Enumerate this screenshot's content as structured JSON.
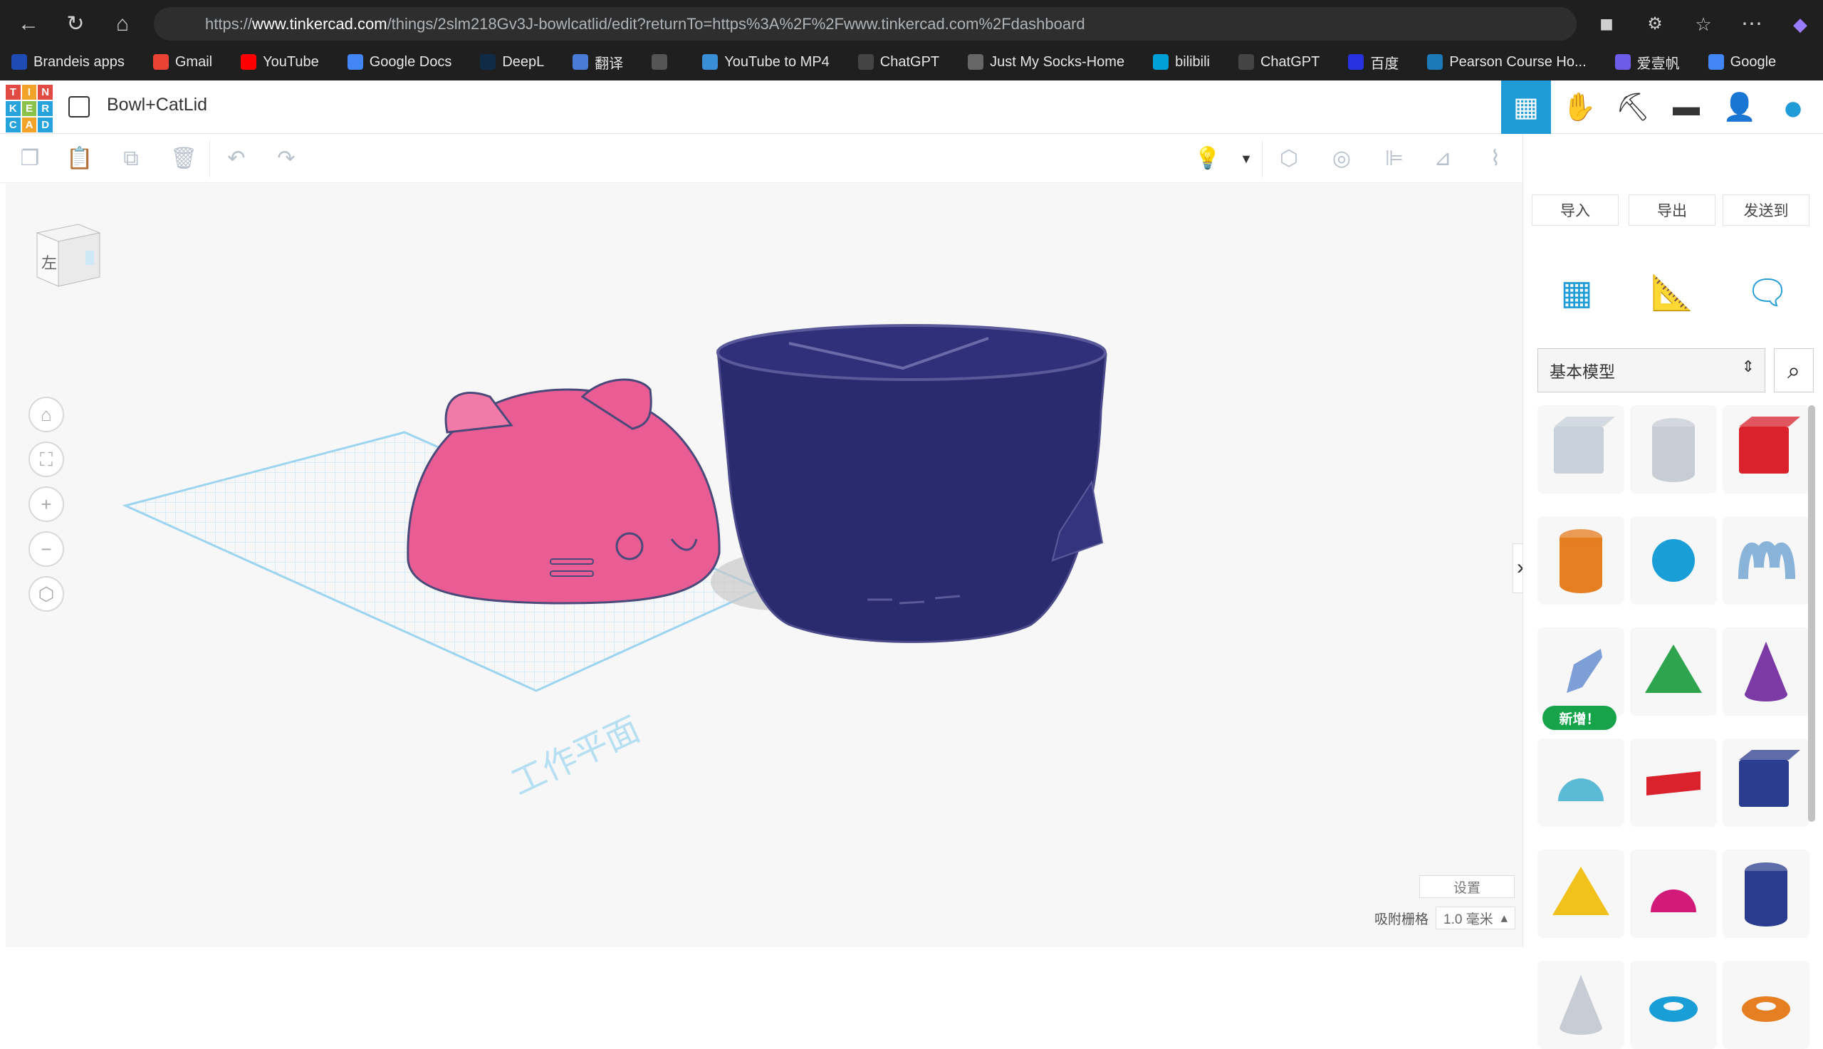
{
  "browser": {
    "url_prefix": "https://",
    "url_host": "www.tinkercad.com",
    "url_path": "/things/2slm218Gv3J-bowlcatlid/edit?returnTo=https%3A%2F%2Fwww.tinkercad.com%2Fdashboard",
    "bookmarks": [
      {
        "label": "Brandeis apps",
        "color": "#1f4bb4"
      },
      {
        "label": "Gmail",
        "color": "#ea4335"
      },
      {
        "label": "YouTube",
        "color": "#ff0000"
      },
      {
        "label": "Google Docs",
        "color": "#4285f4"
      },
      {
        "label": "DeepL",
        "color": "#0f2b46"
      },
      {
        "label": "翻译",
        "color": "#4a7bd6"
      },
      {
        "label": "",
        "color": "#555555"
      },
      {
        "label": "YouTube to MP4",
        "color": "#3a8ed6"
      },
      {
        "label": "ChatGPT",
        "color": "#444444"
      },
      {
        "label": "Just My Socks-Home",
        "color": "#666666"
      },
      {
        "label": "bilibili",
        "color": "#00a1d6"
      },
      {
        "label": "ChatGPT",
        "color": "#444444"
      },
      {
        "label": "百度",
        "color": "#2932e1"
      },
      {
        "label": "Pearson Course Ho...",
        "color": "#1b7ab7"
      },
      {
        "label": "爱壹帆",
        "color": "#6c5ce7"
      },
      {
        "label": "Google",
        "color": "#4285f4"
      }
    ]
  },
  "app": {
    "logo_letters": [
      "T",
      "I",
      "N",
      "K",
      "E",
      "R",
      "C",
      "A",
      "D"
    ],
    "logo_colors": [
      "#e14b43",
      "#f1a32a",
      "#e14b43",
      "#27a3dc",
      "#8bc34a",
      "#27a3dc",
      "#27a3dc",
      "#f1a32a",
      "#27a3dc"
    ],
    "design_title": "Bowl+CatLid",
    "import_label": "导入",
    "export_label": "导出",
    "send_label": "发送到",
    "shape_category": "基本模型",
    "new_badge": "新增！",
    "workplane_label": "工作平面",
    "viewcube_label": "左",
    "settings_label": "设置",
    "snap_grid_label": "吸附栅格",
    "snap_grid_value": "1.0 毫米",
    "accent": "#1f9bd7",
    "lid_color": "#ea5c94",
    "bowl_color": "#2a2a6e"
  }
}
